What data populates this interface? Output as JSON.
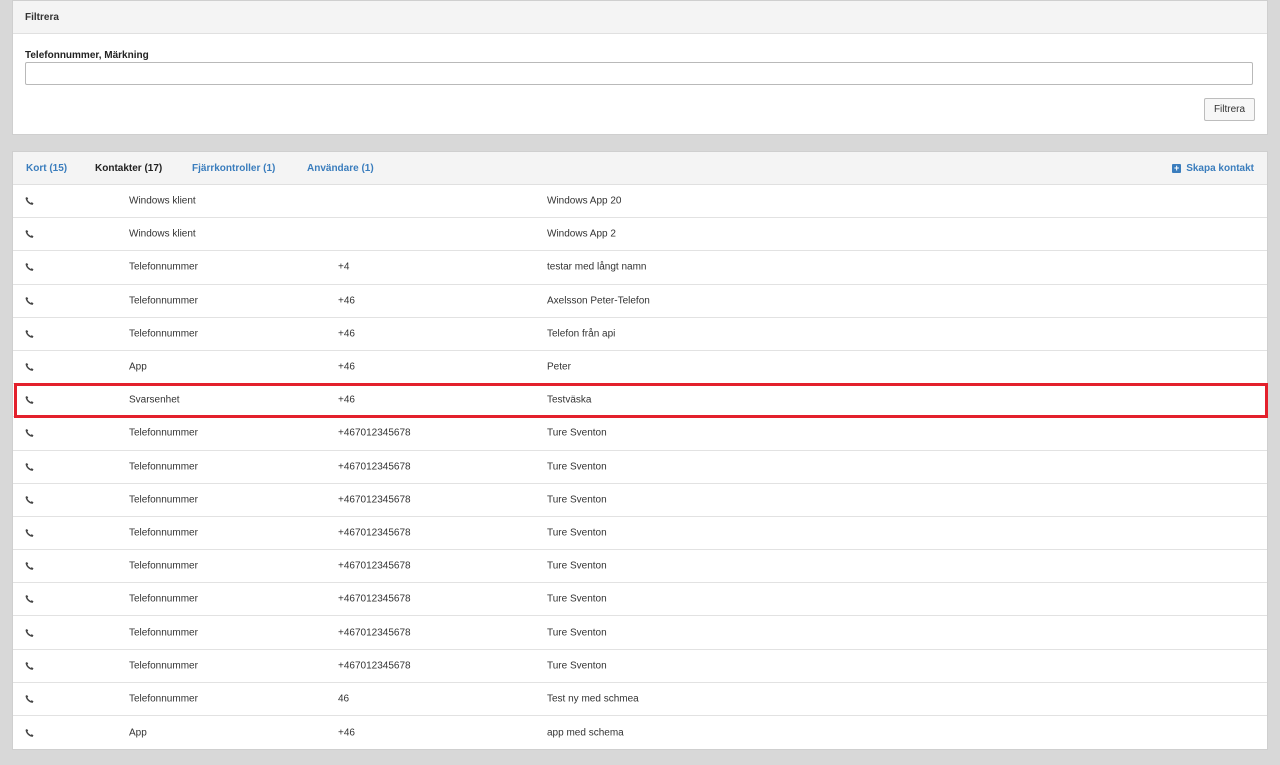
{
  "filter": {
    "title": "Filtrera",
    "field_label": "Telefonnummer, Märkning",
    "input_value": "",
    "button_label": "Filtrera"
  },
  "tabs": [
    {
      "label": "Kort (15)",
      "active": false
    },
    {
      "label": "Kontakter (17)",
      "active": true
    },
    {
      "label": "Fjärrkontroller (1)",
      "active": false
    },
    {
      "label": "Användare (1)",
      "active": false
    }
  ],
  "create_contact": {
    "label": "Skapa kontakt",
    "icon": "plus-square-icon"
  },
  "accent_color": "#3a7dbd",
  "highlight_color": "#e3202c",
  "contacts": [
    {
      "type": "Windows klient",
      "number": "",
      "name": "Windows App 20"
    },
    {
      "type": "Windows klient",
      "number": "",
      "name": "Windows App 2"
    },
    {
      "type": "Telefonnummer",
      "number": "+4",
      "name": "testar med långt namn"
    },
    {
      "type": "Telefonnummer",
      "number": "+46",
      "name": "Axelsson Peter-Telefon"
    },
    {
      "type": "Telefonnummer",
      "number": "+46",
      "name": "Telefon från api"
    },
    {
      "type": "App",
      "number": "+46",
      "name": "Peter"
    },
    {
      "type": "Svarsenhet",
      "number": "+46",
      "name": "Testväska",
      "highlighted": true
    },
    {
      "type": "Telefonnummer",
      "number": "+467012345678",
      "name": "Ture Sventon"
    },
    {
      "type": "Telefonnummer",
      "number": "+467012345678",
      "name": "Ture Sventon"
    },
    {
      "type": "Telefonnummer",
      "number": "+467012345678",
      "name": "Ture Sventon"
    },
    {
      "type": "Telefonnummer",
      "number": "+467012345678",
      "name": "Ture Sventon"
    },
    {
      "type": "Telefonnummer",
      "number": "+467012345678",
      "name": "Ture Sventon"
    },
    {
      "type": "Telefonnummer",
      "number": "+467012345678",
      "name": "Ture Sventon"
    },
    {
      "type": "Telefonnummer",
      "number": "+467012345678",
      "name": "Ture Sventon"
    },
    {
      "type": "Telefonnummer",
      "number": "+467012345678",
      "name": "Ture Sventon"
    },
    {
      "type": "Telefonnummer",
      "number": "46",
      "name": "Test ny med schmea"
    },
    {
      "type": "App",
      "number": "+46",
      "name": "app med schema"
    }
  ]
}
